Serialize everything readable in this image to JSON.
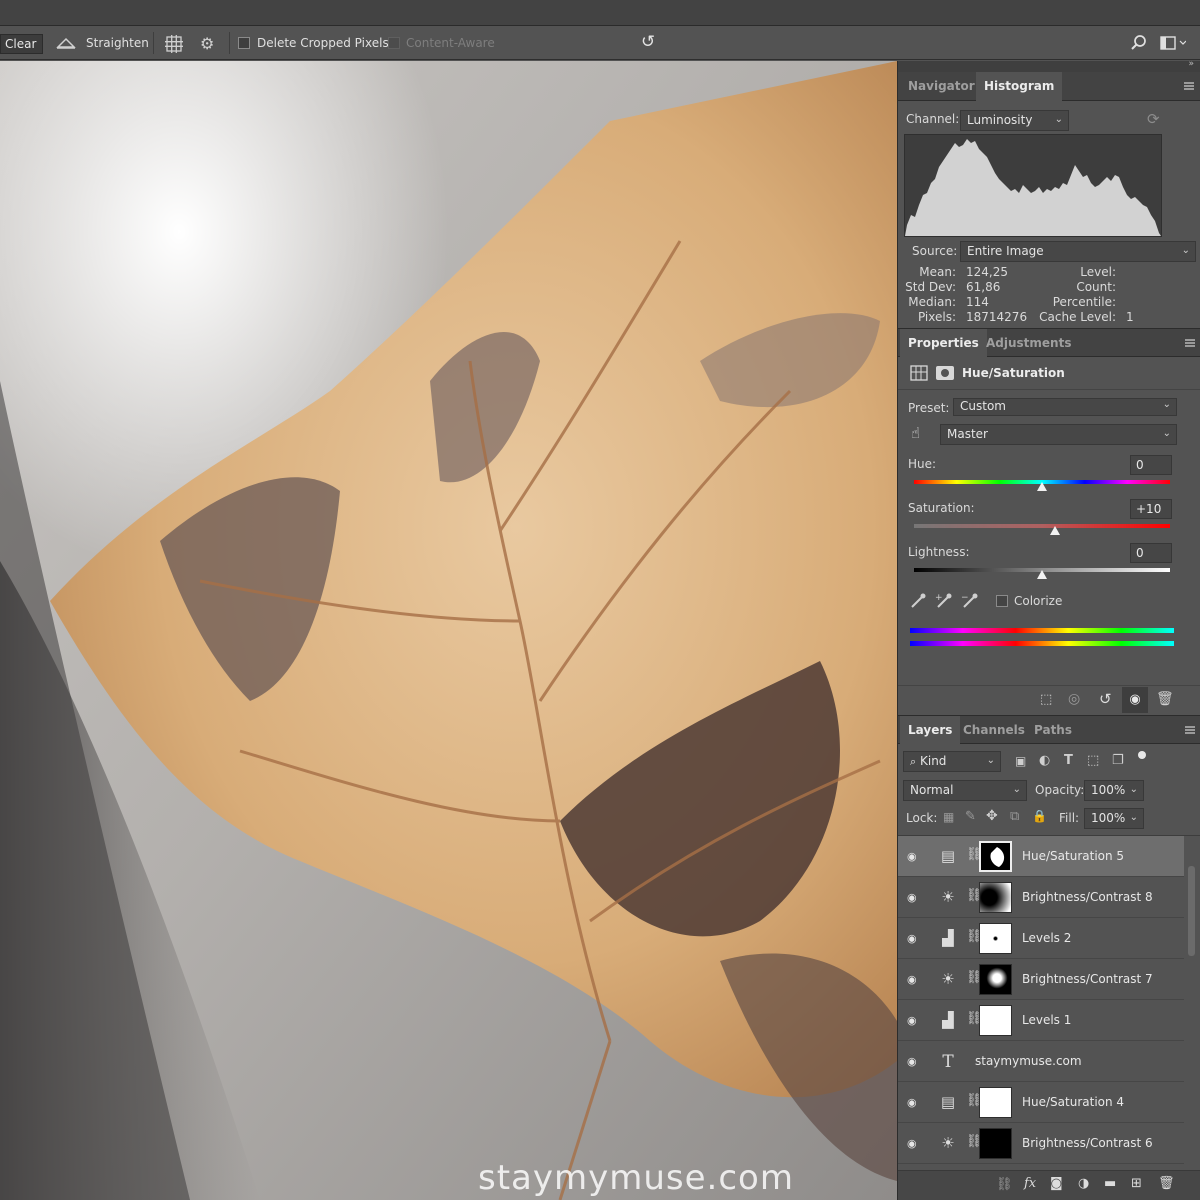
{
  "options_bar": {
    "clear_label": "Clear",
    "straighten_label": "Straighten",
    "delete_cropped_label": "Delete Cropped Pixels",
    "content_aware_label": "Content-Aware",
    "icons": [
      "straighten-icon",
      "grid-overlay-icon",
      "settings-gear-icon",
      "reset-icon",
      "search-icon",
      "workspace-icon"
    ]
  },
  "canvas": {
    "watermark": "staymymuse.com"
  },
  "histogram_panel": {
    "tabs": [
      "Navigator",
      "Histogram"
    ],
    "active_tab": "Histogram",
    "channel_label": "Channel:",
    "channel_value": "Luminosity",
    "source_label": "Source:",
    "source_value": "Entire Image",
    "stats_left": [
      {
        "label": "Mean:",
        "value": "124,25"
      },
      {
        "label": "Std Dev:",
        "value": "61,86"
      },
      {
        "label": "Median:",
        "value": "114"
      },
      {
        "label": "Pixels:",
        "value": "18714276"
      }
    ],
    "stats_right": [
      {
        "label": "Level:",
        "value": ""
      },
      {
        "label": "Count:",
        "value": ""
      },
      {
        "label": "Percentile:",
        "value": ""
      },
      {
        "label": "Cache Level:",
        "value": "1"
      }
    ]
  },
  "properties_panel": {
    "tabs": [
      "Properties",
      "Adjustments"
    ],
    "active_tab": "Properties",
    "title": "Hue/Saturation",
    "preset_label": "Preset:",
    "preset_value": "Custom",
    "range_value": "Master",
    "hue_label": "Hue:",
    "hue_value": "0",
    "hue_fraction": 0.5,
    "saturation_label": "Saturation:",
    "saturation_value": "+10",
    "saturation_fraction": 0.55,
    "lightness_label": "Lightness:",
    "lightness_value": "0",
    "lightness_fraction": 0.5,
    "colorize_label": "Colorize"
  },
  "layers_panel": {
    "tabs": [
      "Layers",
      "Channels",
      "Paths"
    ],
    "active_tab": "Layers",
    "kind_label": "Kind",
    "blend_mode": "Normal",
    "opacity_label": "Opacity:",
    "opacity_value": "100%",
    "lock_label": "Lock:",
    "fill_label": "Fill:",
    "fill_value": "100%",
    "layers": [
      {
        "name": "Hue/Saturation 5",
        "type": "hue-saturation",
        "selected": true
      },
      {
        "name": "Brightness/Contrast 8",
        "type": "brightness-contrast",
        "selected": false
      },
      {
        "name": "Levels 2",
        "type": "levels",
        "selected": false
      },
      {
        "name": "Brightness/Contrast 7",
        "type": "brightness-contrast",
        "selected": false
      },
      {
        "name": "Levels 1",
        "type": "levels",
        "selected": false
      },
      {
        "name": "staymymuse.com",
        "type": "text",
        "selected": false
      },
      {
        "name": "Hue/Saturation 4",
        "type": "hue-saturation",
        "selected": false
      },
      {
        "name": "Brightness/Contrast 6",
        "type": "brightness-contrast",
        "selected": false
      }
    ]
  }
}
